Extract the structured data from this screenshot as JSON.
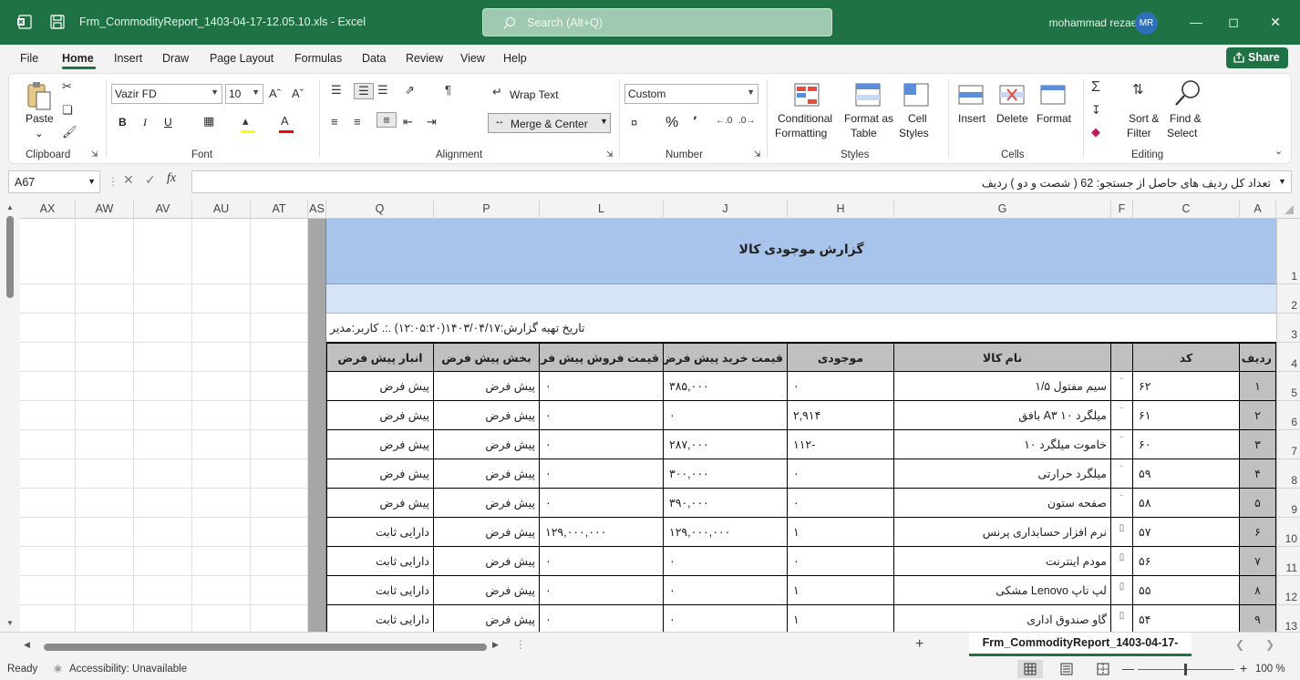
{
  "window": {
    "title": "Frm_CommodityReport_1403-04-17-12.05.10.xls  -  Excel",
    "search_placeholder": "Search (Alt+Q)",
    "user_name": "mohammad rezaei",
    "user_initials": "MR"
  },
  "menu": {
    "items": [
      "File",
      "Home",
      "Insert",
      "Draw",
      "Page Layout",
      "Formulas",
      "Data",
      "Review",
      "View",
      "Help"
    ],
    "share_label": "Share"
  },
  "ribbon": {
    "clipboard": {
      "paste": "Paste",
      "label": "Clipboard"
    },
    "font": {
      "family": "Vazir FD",
      "size": "10",
      "label": "Font",
      "bold": "B",
      "italic": "I",
      "underline": "U"
    },
    "alignment": {
      "wrap": "Wrap Text",
      "merge": "Merge & Center",
      "label": "Alignment"
    },
    "number": {
      "format": "Custom",
      "label": "Number",
      "percent": "%"
    },
    "styles": {
      "conditional": "Conditional",
      "formatting": "Formatting",
      "format_as": "Format as",
      "table": "Table",
      "cell": "Cell",
      "cell_styles": "Styles",
      "label": "Styles"
    },
    "cells": {
      "insert": "Insert",
      "delete": "Delete",
      "format": "Format",
      "label": "Cells"
    },
    "editing": {
      "sort": "Sort &",
      "filter": "Filter",
      "find": "Find &",
      "select": "Select",
      "label": "Editing"
    }
  },
  "formula_bar": {
    "name_box": "A67",
    "content": "تعداد کل ردیف های حاصل از جستجو: 62 ( شصت و دو  ) ردیف"
  },
  "columns": [
    "AX",
    "AW",
    "AV",
    "AU",
    "AT",
    "AS",
    "Q",
    "P",
    "L",
    "J",
    "H",
    "G",
    "F",
    "C",
    "A"
  ],
  "rows": [
    "1",
    "2",
    "3",
    "4",
    "5",
    "6",
    "7",
    "8",
    "9",
    "10",
    "11",
    "12",
    "13"
  ],
  "report": {
    "title": "گزارش موجودی کالا",
    "info": "تاریخ تهیه گزارش:۱۴۰۳/۰۴/۱۷(۱۲:۰۵:۲۰) .:. کاربر:مدیر",
    "headers": [
      "ردیف",
      "کد",
      "",
      "نام کالا",
      "موجودی",
      "قیمت خرید پیش فرض",
      "قیمت فروش پیش فرض",
      "بخش پیش فرض",
      "انبار پیش فرض"
    ],
    "rows": [
      [
        "۱",
        "۶۲",
        "¨",
        "سیم مفتول ۱/۵",
        "۰",
        "۳۸۵,۰۰۰",
        "۰",
        "پیش فرض",
        "پیش فرض"
      ],
      [
        "۲",
        "۶۱",
        "¨",
        "میلگرد ۱۰  A۳ بافق",
        "۲,۹۱۴",
        "۰",
        "۰",
        "پیش فرض",
        "پیش فرض"
      ],
      [
        "۳",
        "۶۰",
        "¨",
        "خاموت میلگرد ۱۰",
        "-۱۱۲",
        "۲۸۷,۰۰۰",
        "۰",
        "پیش فرض",
        "پیش فرض"
      ],
      [
        "۴",
        "۵۹",
        "¨",
        "میلگرد حرارتی",
        "۰",
        "۳۰۰,۰۰۰",
        "۰",
        "پیش فرض",
        "پیش فرض"
      ],
      [
        "۵",
        "۵۸",
        "¨",
        "صفحه ستون",
        "۰",
        "۳۹۰,۰۰۰",
        "۰",
        "پیش فرض",
        "پیش فرض"
      ],
      [
        "۶",
        "۵۷",
        "▯",
        "نرم افزار حسابداری پرنس",
        "۱",
        "۱۲۹,۰۰۰,۰۰۰",
        "۱۲۹,۰۰۰,۰۰۰",
        "پیش فرض",
        "دارایی ثابت"
      ],
      [
        "۷",
        "۵۶",
        "▯",
        "مودم اینترنت",
        "۰",
        "۰",
        "۰",
        "پیش فرض",
        "دارایی ثابت"
      ],
      [
        "۸",
        "۵۵",
        "▯",
        "لپ تاپ Lenovo مشکی",
        "۱",
        "۰",
        "۰",
        "پیش فرض",
        "دارایی ثابت"
      ],
      [
        "۹",
        "۵۴",
        "▯",
        "گاو صندوق اداری",
        "۱",
        "۰",
        "۰",
        "پیش فرض",
        "دارایی ثابت"
      ]
    ]
  },
  "sheet_tab": "Frm_CommodityReport_1403-04-17-",
  "status": {
    "ready": "Ready",
    "accessibility": "Accessibility: Unavailable",
    "zoom": "100 %"
  },
  "colors": {
    "accent": "#1f7244",
    "header_fill": "#c0c0c0",
    "title_fill": "#a9c4eb",
    "row2_fill": "#d6e4f8"
  }
}
